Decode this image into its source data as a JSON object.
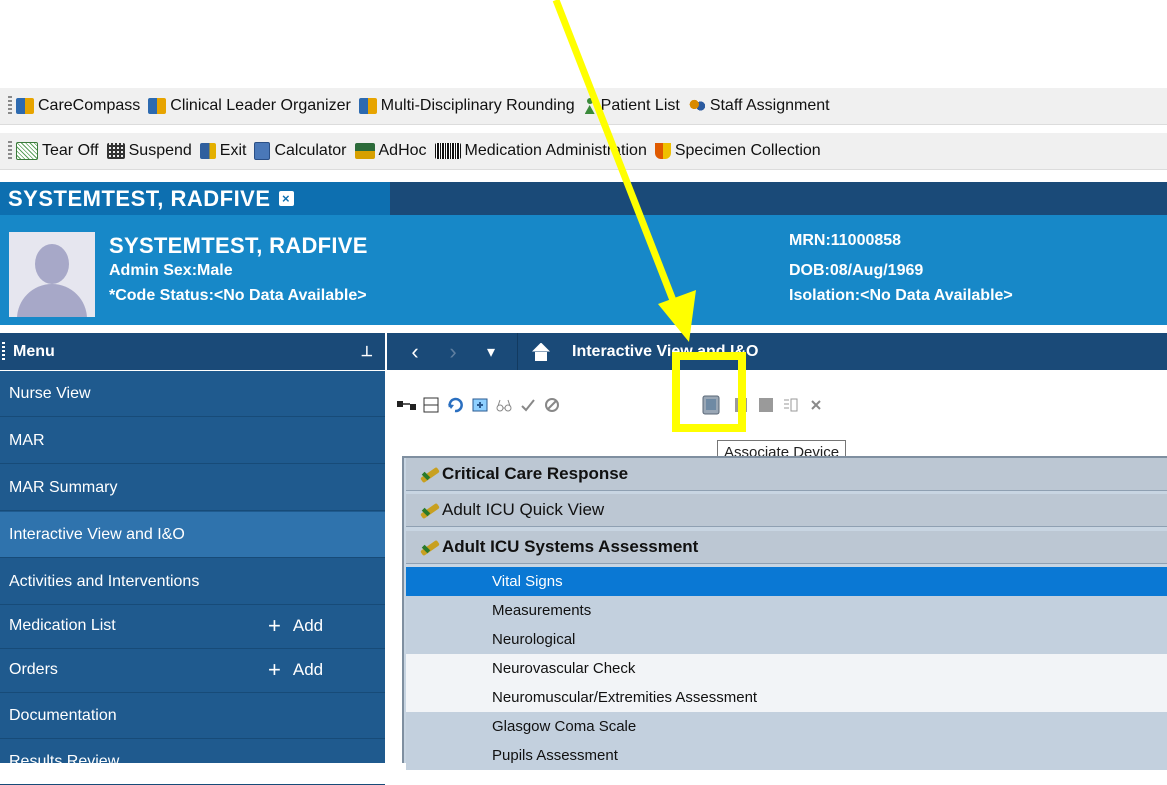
{
  "toolbar1": [
    {
      "label": "CareCompass",
      "icon": "grid-icon"
    },
    {
      "label": "Clinical Leader Organizer",
      "icon": "grid-icon"
    },
    {
      "label": "Multi-Disciplinary Rounding",
      "icon": "grid-icon"
    },
    {
      "label": "Patient List",
      "icon": "person-icon"
    },
    {
      "label": "Staff Assignment",
      "icon": "staff-icon"
    }
  ],
  "toolbar2": [
    {
      "label": "Tear Off",
      "icon": "tear-off-icon"
    },
    {
      "label": "Suspend",
      "icon": "suspend-icon"
    },
    {
      "label": "Exit",
      "icon": "exit-icon"
    },
    {
      "label": "Calculator",
      "icon": "calculator-icon"
    },
    {
      "label": "AdHoc",
      "icon": "adhoc-icon"
    },
    {
      "label": "Medication Administration",
      "icon": "barcode-icon"
    },
    {
      "label": "Specimen Collection",
      "icon": "flask-icon"
    }
  ],
  "patient_tab": {
    "label": "SYSTEMTEST, RADFIVE",
    "close": "×"
  },
  "banner": {
    "name": "SYSTEMTEST, RADFIVE",
    "admin_sex": "Admin Sex:Male",
    "code_status": "*Code Status:<No Data Available>",
    "mrn": "MRN:11000858",
    "dob": "DOB:08/Aug/1969",
    "isolation": "Isolation:<No Data Available>"
  },
  "menu": {
    "title": "Menu",
    "pin": "⊥",
    "items": [
      {
        "label": "Nurse View"
      },
      {
        "label": "MAR"
      },
      {
        "label": "MAR Summary"
      },
      {
        "label": "Interactive View and I&O",
        "active": true
      },
      {
        "label": "Activities and Interventions"
      },
      {
        "label": "Medication List",
        "add": "Add"
      },
      {
        "label": "Orders",
        "add": "Add"
      },
      {
        "label": "Documentation"
      },
      {
        "label": "Results Review"
      }
    ],
    "add_plus": "+"
  },
  "navbar": {
    "back": "‹",
    "forward": "›",
    "dropdown": "▾",
    "title": "Interactive View and I&O"
  },
  "tooltip": "Associate Device",
  "sections": [
    {
      "label": "Critical Care Response",
      "bold": true
    },
    {
      "label": "Adult ICU Quick View",
      "bold": false
    },
    {
      "label": "Adult ICU Systems Assessment",
      "bold": true
    }
  ],
  "subitems": [
    {
      "label": "Vital Signs",
      "style": "selected"
    },
    {
      "label": "Measurements",
      "style": "alt"
    },
    {
      "label": "Neurological",
      "style": "alt"
    },
    {
      "label": "Neurovascular Check",
      "style": "white"
    },
    {
      "label": "Neuromuscular/Extremities Assessment",
      "style": "white"
    },
    {
      "label": "Glasgow Coma Scale",
      "style": "alt"
    },
    {
      "label": "Pupils Assessment",
      "style": "alt"
    }
  ],
  "colors": {
    "highlight": "#ffff00",
    "arrow": "#ffff00",
    "banner": "#1788c8",
    "selected": "#0a78d4"
  }
}
